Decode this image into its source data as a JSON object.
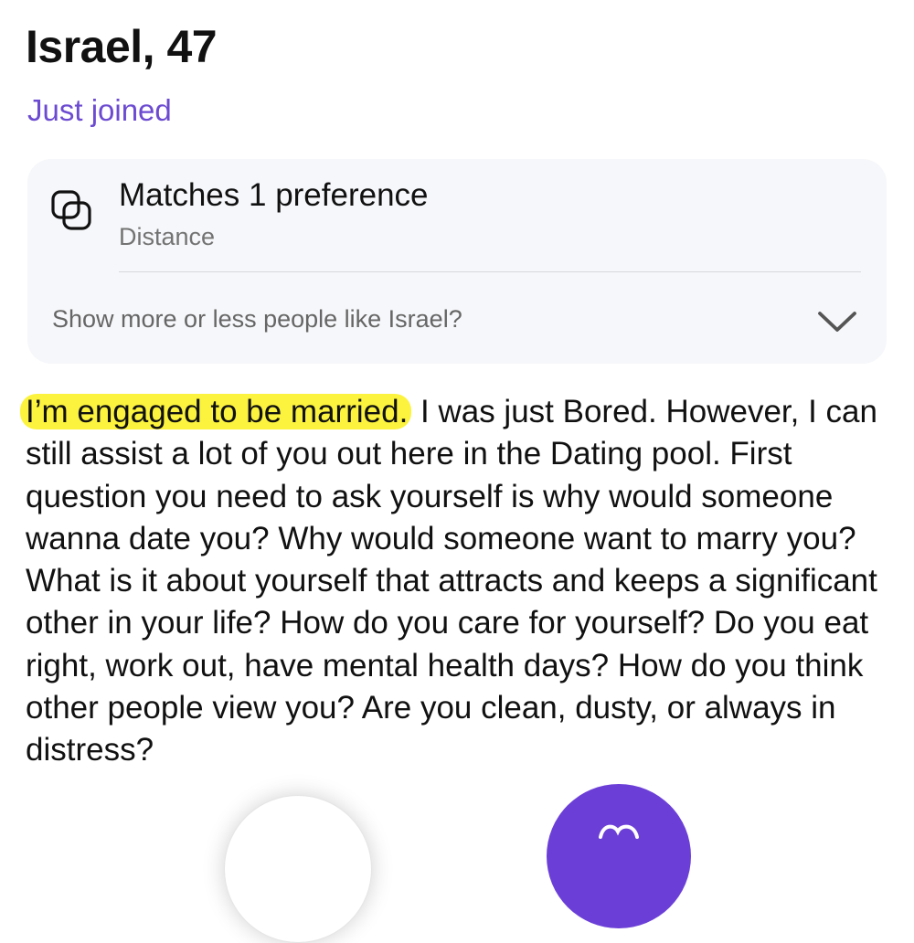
{
  "profile": {
    "name_age": "Israel, 47",
    "status": "Just joined"
  },
  "preference_card": {
    "title": "Matches 1 preference",
    "subtitle": "Distance",
    "prompt": "Show more or less people like Israel?"
  },
  "bio": {
    "highlighted": "I’m engaged to be married.",
    "text": " I was just Bored. However, I can still assist a lot of you out here in the Dating pool. First question you need to ask yourself is why would someone wanna date you? Why would someone want to marry you? What is it about yourself that attracts and keeps a significant other in your life? How do you care for yourself? Do you eat right, work out, have mental health days? How do you think other people view you? Are you clean, dusty, or always in distress?"
  },
  "colors": {
    "accent": "#6c4bd1",
    "highlight": "#fbf33e",
    "card_bg": "#f6f7fa",
    "action_button": "#6b3fd7"
  },
  "icons": {
    "preference": "overlapping-squares-icon",
    "expand": "chevron-down-icon"
  }
}
